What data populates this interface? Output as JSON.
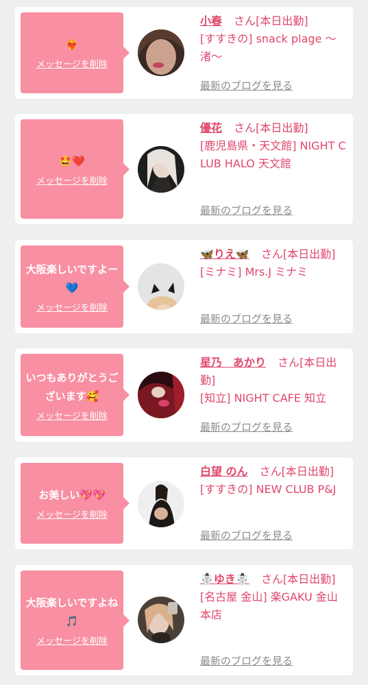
{
  "colors": {
    "bubble": "#f88fa2",
    "accent_text": "#e0466a",
    "link_gray": "#8b8b8b",
    "background": "#efefef",
    "card": "#ffffff"
  },
  "messages": [
    {
      "message": "❤️‍🔥",
      "delete_label": "メッセージを削除",
      "cast_name": "小春",
      "suffix": "さん[本日出勤]",
      "shop": "[すすきの] snack plage ～渚～",
      "blog_label": "最新のブログを見る",
      "avatar_icon": "avatar-photo"
    },
    {
      "message": "🤩❤️",
      "delete_label": "メッセージを削除",
      "cast_name": "優花",
      "suffix": "さん[本日出勤]",
      "shop": "[鹿児島県・天文館] NIGHT CLUB HALO 天文館",
      "blog_label": "最新のブログを見る",
      "avatar_icon": "avatar-photo"
    },
    {
      "message": "大阪楽しいですよー💙",
      "delete_label": "メッセージを削除",
      "cast_name": "🦋りえ🦋",
      "suffix": "さん[本日出勤]",
      "shop": "[ミナミ] Mrs.J ミナミ",
      "blog_label": "最新のブログを見る",
      "avatar_icon": "avatar-photo"
    },
    {
      "message": "いつもありがとうございます🥰",
      "delete_label": "メッセージを削除",
      "cast_name": "星乃　あかり",
      "suffix": "さん[本日出勤]",
      "shop": "[知立] NIGHT CAFE 知立",
      "blog_label": "最新のブログを見る",
      "avatar_icon": "avatar-photo"
    },
    {
      "message": "お美しい💖💖",
      "delete_label": "メッセージを削除",
      "cast_name": "白望 のん",
      "suffix": "さん[本日出勤]",
      "shop": "[すすきの] NEW CLUB P&J",
      "blog_label": "最新のブログを見る",
      "avatar_icon": "avatar-photo"
    },
    {
      "message": "大阪楽しいですよね🎵",
      "delete_label": "メッセージを削除",
      "cast_name": "☃️ゆき☃️",
      "suffix": "さん[本日出勤]",
      "shop": "[名古屋 金山] 楽GAKU 金山本店",
      "blog_label": "最新のブログを見る",
      "avatar_icon": "avatar-photo"
    }
  ]
}
